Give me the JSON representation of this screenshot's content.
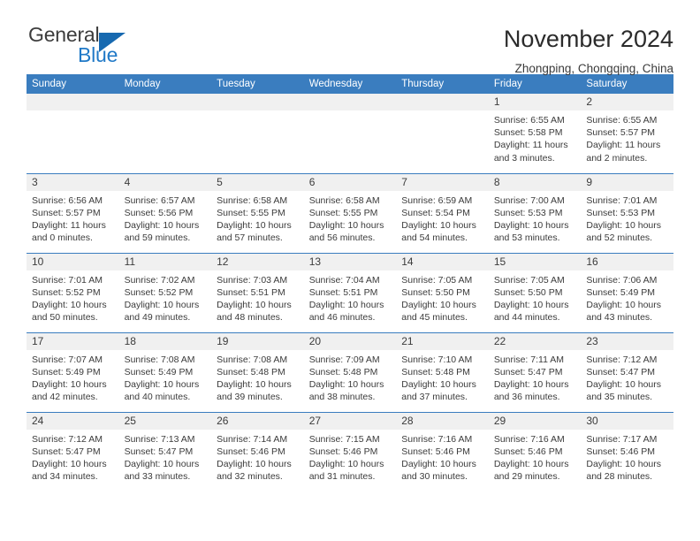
{
  "brand": {
    "name_part1": "General",
    "name_part2": "Blue",
    "logo_icon": "triangle-logo-icon"
  },
  "header": {
    "title": "November 2024",
    "location": "Zhongping, Chongqing, China"
  },
  "calendar": {
    "accent_color": "#3a7dbf",
    "daynum_band_color": "#f0f0f0",
    "weekday_headers": [
      "Sunday",
      "Monday",
      "Tuesday",
      "Wednesday",
      "Thursday",
      "Friday",
      "Saturday"
    ],
    "weeks": [
      [
        {
          "day": "",
          "empty": true
        },
        {
          "day": "",
          "empty": true
        },
        {
          "day": "",
          "empty": true
        },
        {
          "day": "",
          "empty": true
        },
        {
          "day": "",
          "empty": true
        },
        {
          "day": "1",
          "sunrise": "Sunrise: 6:55 AM",
          "sunset": "Sunset: 5:58 PM",
          "daylight_line1": "Daylight: 11 hours",
          "daylight_line2": "and 3 minutes."
        },
        {
          "day": "2",
          "sunrise": "Sunrise: 6:55 AM",
          "sunset": "Sunset: 5:57 PM",
          "daylight_line1": "Daylight: 11 hours",
          "daylight_line2": "and 2 minutes."
        }
      ],
      [
        {
          "day": "3",
          "sunrise": "Sunrise: 6:56 AM",
          "sunset": "Sunset: 5:57 PM",
          "daylight_line1": "Daylight: 11 hours",
          "daylight_line2": "and 0 minutes."
        },
        {
          "day": "4",
          "sunrise": "Sunrise: 6:57 AM",
          "sunset": "Sunset: 5:56 PM",
          "daylight_line1": "Daylight: 10 hours",
          "daylight_line2": "and 59 minutes."
        },
        {
          "day": "5",
          "sunrise": "Sunrise: 6:58 AM",
          "sunset": "Sunset: 5:55 PM",
          "daylight_line1": "Daylight: 10 hours",
          "daylight_line2": "and 57 minutes."
        },
        {
          "day": "6",
          "sunrise": "Sunrise: 6:58 AM",
          "sunset": "Sunset: 5:55 PM",
          "daylight_line1": "Daylight: 10 hours",
          "daylight_line2": "and 56 minutes."
        },
        {
          "day": "7",
          "sunrise": "Sunrise: 6:59 AM",
          "sunset": "Sunset: 5:54 PM",
          "daylight_line1": "Daylight: 10 hours",
          "daylight_line2": "and 54 minutes."
        },
        {
          "day": "8",
          "sunrise": "Sunrise: 7:00 AM",
          "sunset": "Sunset: 5:53 PM",
          "daylight_line1": "Daylight: 10 hours",
          "daylight_line2": "and 53 minutes."
        },
        {
          "day": "9",
          "sunrise": "Sunrise: 7:01 AM",
          "sunset": "Sunset: 5:53 PM",
          "daylight_line1": "Daylight: 10 hours",
          "daylight_line2": "and 52 minutes."
        }
      ],
      [
        {
          "day": "10",
          "sunrise": "Sunrise: 7:01 AM",
          "sunset": "Sunset: 5:52 PM",
          "daylight_line1": "Daylight: 10 hours",
          "daylight_line2": "and 50 minutes."
        },
        {
          "day": "11",
          "sunrise": "Sunrise: 7:02 AM",
          "sunset": "Sunset: 5:52 PM",
          "daylight_line1": "Daylight: 10 hours",
          "daylight_line2": "and 49 minutes."
        },
        {
          "day": "12",
          "sunrise": "Sunrise: 7:03 AM",
          "sunset": "Sunset: 5:51 PM",
          "daylight_line1": "Daylight: 10 hours",
          "daylight_line2": "and 48 minutes."
        },
        {
          "day": "13",
          "sunrise": "Sunrise: 7:04 AM",
          "sunset": "Sunset: 5:51 PM",
          "daylight_line1": "Daylight: 10 hours",
          "daylight_line2": "and 46 minutes."
        },
        {
          "day": "14",
          "sunrise": "Sunrise: 7:05 AM",
          "sunset": "Sunset: 5:50 PM",
          "daylight_line1": "Daylight: 10 hours",
          "daylight_line2": "and 45 minutes."
        },
        {
          "day": "15",
          "sunrise": "Sunrise: 7:05 AM",
          "sunset": "Sunset: 5:50 PM",
          "daylight_line1": "Daylight: 10 hours",
          "daylight_line2": "and 44 minutes."
        },
        {
          "day": "16",
          "sunrise": "Sunrise: 7:06 AM",
          "sunset": "Sunset: 5:49 PM",
          "daylight_line1": "Daylight: 10 hours",
          "daylight_line2": "and 43 minutes."
        }
      ],
      [
        {
          "day": "17",
          "sunrise": "Sunrise: 7:07 AM",
          "sunset": "Sunset: 5:49 PM",
          "daylight_line1": "Daylight: 10 hours",
          "daylight_line2": "and 42 minutes."
        },
        {
          "day": "18",
          "sunrise": "Sunrise: 7:08 AM",
          "sunset": "Sunset: 5:49 PM",
          "daylight_line1": "Daylight: 10 hours",
          "daylight_line2": "and 40 minutes."
        },
        {
          "day": "19",
          "sunrise": "Sunrise: 7:08 AM",
          "sunset": "Sunset: 5:48 PM",
          "daylight_line1": "Daylight: 10 hours",
          "daylight_line2": "and 39 minutes."
        },
        {
          "day": "20",
          "sunrise": "Sunrise: 7:09 AM",
          "sunset": "Sunset: 5:48 PM",
          "daylight_line1": "Daylight: 10 hours",
          "daylight_line2": "and 38 minutes."
        },
        {
          "day": "21",
          "sunrise": "Sunrise: 7:10 AM",
          "sunset": "Sunset: 5:48 PM",
          "daylight_line1": "Daylight: 10 hours",
          "daylight_line2": "and 37 minutes."
        },
        {
          "day": "22",
          "sunrise": "Sunrise: 7:11 AM",
          "sunset": "Sunset: 5:47 PM",
          "daylight_line1": "Daylight: 10 hours",
          "daylight_line2": "and 36 minutes."
        },
        {
          "day": "23",
          "sunrise": "Sunrise: 7:12 AM",
          "sunset": "Sunset: 5:47 PM",
          "daylight_line1": "Daylight: 10 hours",
          "daylight_line2": "and 35 minutes."
        }
      ],
      [
        {
          "day": "24",
          "sunrise": "Sunrise: 7:12 AM",
          "sunset": "Sunset: 5:47 PM",
          "daylight_line1": "Daylight: 10 hours",
          "daylight_line2": "and 34 minutes."
        },
        {
          "day": "25",
          "sunrise": "Sunrise: 7:13 AM",
          "sunset": "Sunset: 5:47 PM",
          "daylight_line1": "Daylight: 10 hours",
          "daylight_line2": "and 33 minutes."
        },
        {
          "day": "26",
          "sunrise": "Sunrise: 7:14 AM",
          "sunset": "Sunset: 5:46 PM",
          "daylight_line1": "Daylight: 10 hours",
          "daylight_line2": "and 32 minutes."
        },
        {
          "day": "27",
          "sunrise": "Sunrise: 7:15 AM",
          "sunset": "Sunset: 5:46 PM",
          "daylight_line1": "Daylight: 10 hours",
          "daylight_line2": "and 31 minutes."
        },
        {
          "day": "28",
          "sunrise": "Sunrise: 7:16 AM",
          "sunset": "Sunset: 5:46 PM",
          "daylight_line1": "Daylight: 10 hours",
          "daylight_line2": "and 30 minutes."
        },
        {
          "day": "29",
          "sunrise": "Sunrise: 7:16 AM",
          "sunset": "Sunset: 5:46 PM",
          "daylight_line1": "Daylight: 10 hours",
          "daylight_line2": "and 29 minutes."
        },
        {
          "day": "30",
          "sunrise": "Sunrise: 7:17 AM",
          "sunset": "Sunset: 5:46 PM",
          "daylight_line1": "Daylight: 10 hours",
          "daylight_line2": "and 28 minutes."
        }
      ]
    ]
  }
}
